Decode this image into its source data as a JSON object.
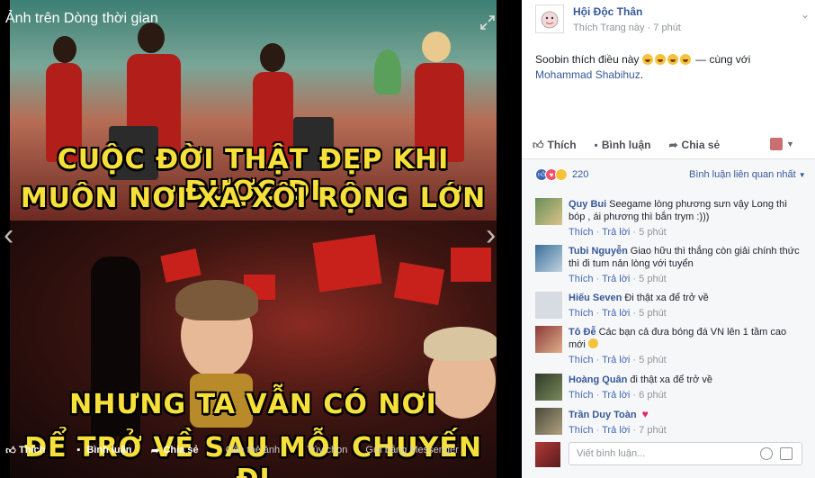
{
  "stage": {
    "title": "Ảnh trên Dòng thời gian",
    "meme_line1": "CUỘC ĐỜI THẬT ĐẸP KHI ĐƯỢC ĐI",
    "meme_line2": "MUÔN NƠI XA XÔI RỘNG LỚN",
    "meme_line3": "NHƯNG TA VẪN CÓ NƠI",
    "meme_line4": "ĐỂ TRỞ VỀ SAU MỖI CHUYẾN ĐI",
    "actions": {
      "like": "Thích",
      "comment": "Bình luận",
      "share": "Chia sẻ",
      "tag": "Gắn thẻ ảnh",
      "options": "Tùy chọn",
      "messenger": "Gửi bằng Messenger"
    }
  },
  "post": {
    "page_name": "Hội Độc Thân",
    "meta_link": "Thích Trang này",
    "meta_sep": " · ",
    "meta_time": "7 phút",
    "text_prefix": "Soobin thích điều này",
    "text_with": "— cùng với",
    "text_tagged": "Mohammad Shabihuz",
    "text_end": ".",
    "actions": {
      "like": "Thích",
      "comment": "Bình luận",
      "share": "Chia sẻ"
    }
  },
  "reactions": {
    "count": "220",
    "sort_label": "Bình luận liên quan nhất"
  },
  "comments": [
    {
      "name": "Quy Bui",
      "text": "Seegame lòng phương sưn vậy Long thì bóp , ái phương thì bắn trym :)))",
      "like": "Thích",
      "reply": "Trả lời",
      "time": "5 phút"
    },
    {
      "name": "Tubi Nguyễn",
      "text": "Giao hữu thì thắng còn giải chính thức thì đi tum nản lòng với tuyển",
      "like": "Thích",
      "reply": "Trả lời",
      "time": "5 phút"
    },
    {
      "name": "Hiếu Seven",
      "text": "Đi thật xa để trở về",
      "like": "Thích",
      "reply": "Trả lời",
      "time": "5 phút"
    },
    {
      "name": "Tô Đễ",
      "text": "Các bạn cả đưa bóng đá VN lên 1 tầm cao mới",
      "like": "Thích",
      "reply": "Trả lời",
      "time": "5 phút"
    },
    {
      "name": "Hoàng Quân",
      "text": "đi thật xa để trở về",
      "like": "Thích",
      "reply": "Trả lời",
      "time": "6 phút"
    },
    {
      "name": "Trần Duy Toàn",
      "text": "",
      "like": "Thích",
      "reply": "Trả lời",
      "time": "7 phút"
    }
  ],
  "write": {
    "placeholder": "Viết bình luận..."
  },
  "separator": "·"
}
